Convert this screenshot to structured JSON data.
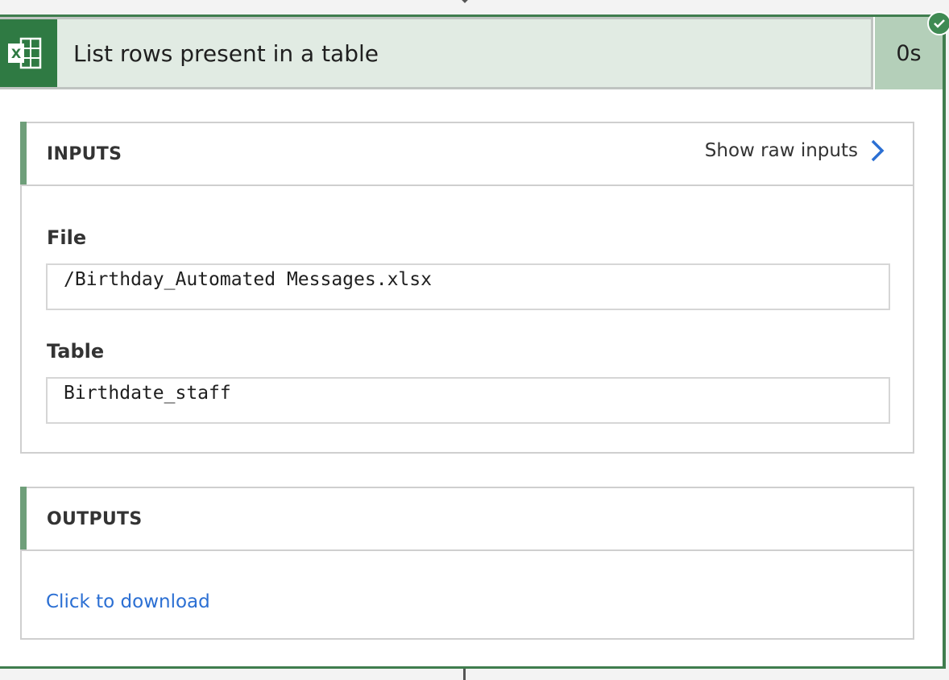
{
  "action": {
    "title": "List rows present in a table",
    "duration": "0s",
    "icon": "excel-icon",
    "status": "succeeded",
    "colors": {
      "accent": "#3f7d4e",
      "header_bg": "#e1ebe3",
      "duration_bg": "#b4cfb9",
      "link": "#2b6fd3"
    }
  },
  "inputs": {
    "title": "INPUTS",
    "raw_link": "Show raw inputs",
    "fields": [
      {
        "label": "File",
        "value": "/Birthday_Automated Messages.xlsx"
      },
      {
        "label": "Table",
        "value": "Birthdate_staff"
      }
    ]
  },
  "outputs": {
    "title": "OUTPUTS",
    "download_link": "Click to download"
  }
}
